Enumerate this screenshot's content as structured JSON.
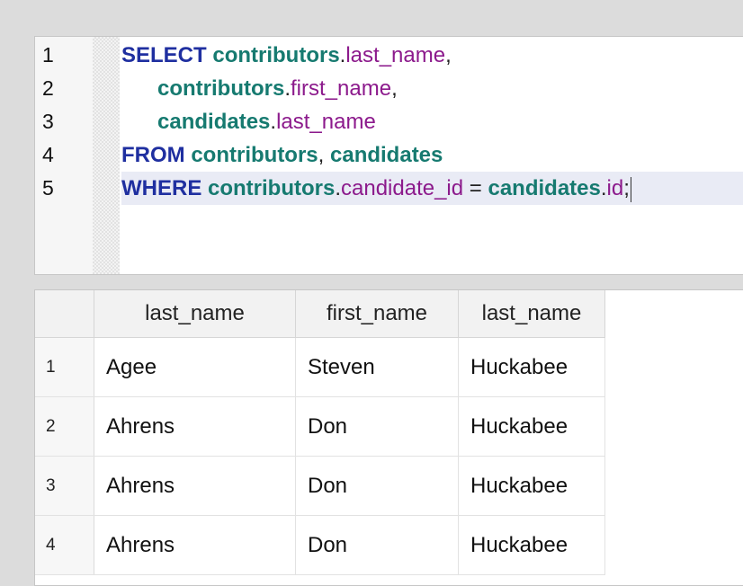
{
  "editor": {
    "line_numbers": [
      "1",
      "2",
      "3",
      "4",
      "5"
    ],
    "lines": [
      [
        {
          "t": "kw",
          "v": "SELECT "
        },
        {
          "t": "tbl",
          "v": "contributors"
        },
        {
          "t": "pn",
          "v": "."
        },
        {
          "t": "col",
          "v": "last_name"
        },
        {
          "t": "pn",
          "v": ","
        }
      ],
      [
        {
          "t": "pn",
          "v": "      "
        },
        {
          "t": "tbl",
          "v": "contributors"
        },
        {
          "t": "pn",
          "v": "."
        },
        {
          "t": "col",
          "v": "first_name"
        },
        {
          "t": "pn",
          "v": ","
        }
      ],
      [
        {
          "t": "pn",
          "v": "      "
        },
        {
          "t": "tbl",
          "v": "candidates"
        },
        {
          "t": "pn",
          "v": "."
        },
        {
          "t": "col",
          "v": "last_name"
        }
      ],
      [
        {
          "t": "kw",
          "v": "FROM "
        },
        {
          "t": "tbl",
          "v": "contributors"
        },
        {
          "t": "pn",
          "v": ", "
        },
        {
          "t": "tbl",
          "v": "candidates"
        }
      ],
      [
        {
          "t": "kw",
          "v": "WHERE "
        },
        {
          "t": "tbl",
          "v": "contributors"
        },
        {
          "t": "pn",
          "v": "."
        },
        {
          "t": "col",
          "v": "candidate_id"
        },
        {
          "t": "pn",
          "v": " = "
        },
        {
          "t": "tbl",
          "v": "candidates"
        },
        {
          "t": "pn",
          "v": "."
        },
        {
          "t": "col",
          "v": "id"
        },
        {
          "t": "pn",
          "v": ";"
        }
      ]
    ],
    "active_line": 5
  },
  "results": {
    "columns": [
      "last_name",
      "first_name",
      "last_name"
    ],
    "rows": [
      {
        "num": "1",
        "cells": [
          "Agee",
          "Steven",
          "Huckabee"
        ]
      },
      {
        "num": "2",
        "cells": [
          "Ahrens",
          "Don",
          "Huckabee"
        ]
      },
      {
        "num": "3",
        "cells": [
          "Ahrens",
          "Don",
          "Huckabee"
        ]
      },
      {
        "num": "4",
        "cells": [
          "Ahrens",
          "Don",
          "Huckabee"
        ]
      }
    ]
  },
  "colors": {
    "keyword": "#1f2fa0",
    "table": "#167a70",
    "column": "#8c1a8c",
    "active_line": "#e9ebf5"
  }
}
